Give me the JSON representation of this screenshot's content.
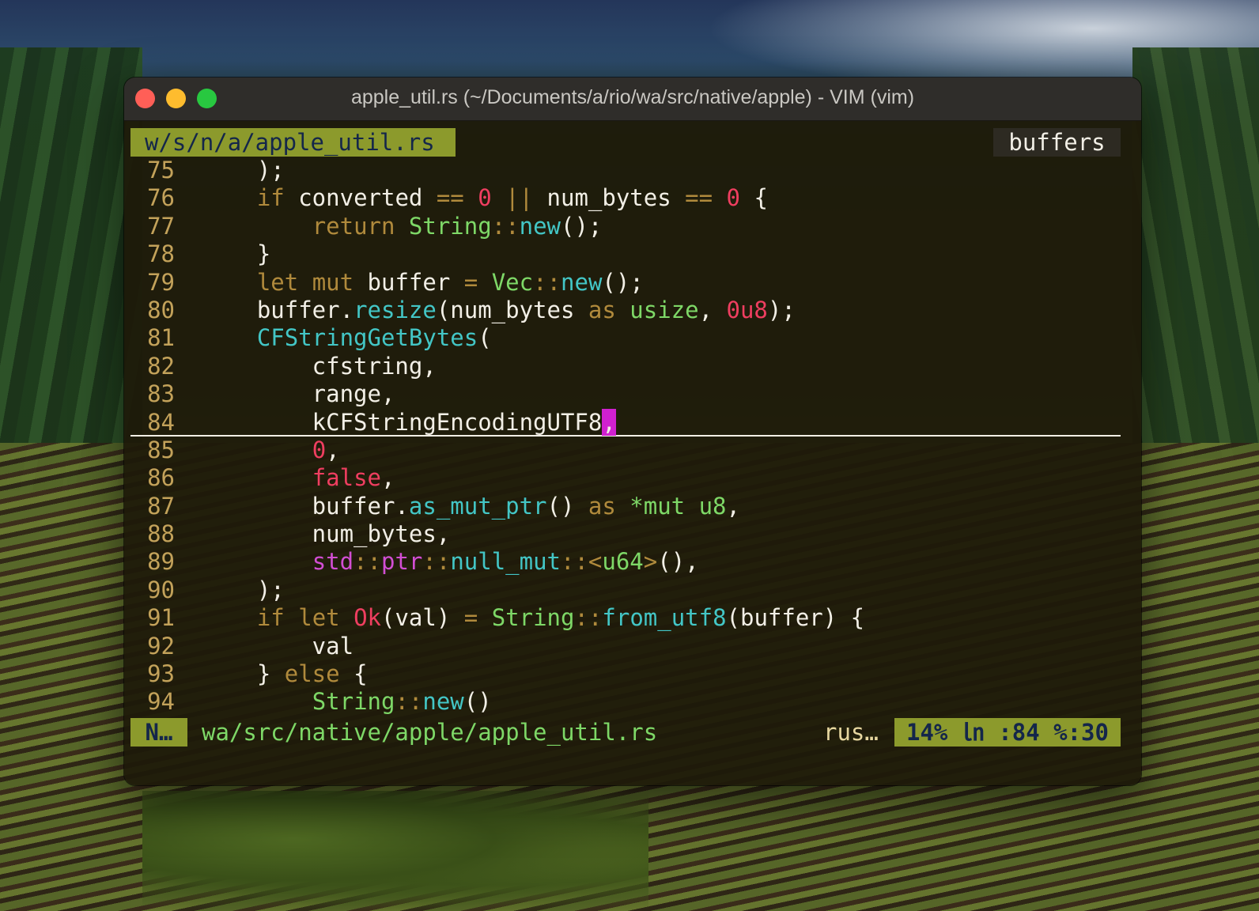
{
  "window": {
    "title": "apple_util.rs (~/Documents/a/rio/wa/src/native/apple) - VIM (vim)"
  },
  "tabline": {
    "file_tab": "w/s/n/a/apple_util.rs",
    "buffers_label": "buffers"
  },
  "editor": {
    "cursor_line": 84,
    "lines": [
      {
        "n": "75",
        "code": "    );"
      },
      {
        "n": "76",
        "code": "    if converted == 0 || num_bytes == 0 {"
      },
      {
        "n": "77",
        "code": "        return String::new();"
      },
      {
        "n": "78",
        "code": "    }"
      },
      {
        "n": "79",
        "code": "    let mut buffer = Vec::new();"
      },
      {
        "n": "80",
        "code": "    buffer.resize(num_bytes as usize, 0u8);"
      },
      {
        "n": "81",
        "code": "    CFStringGetBytes("
      },
      {
        "n": "82",
        "code": "        cfstring,"
      },
      {
        "n": "83",
        "code": "        range,"
      },
      {
        "n": "84",
        "code": "        kCFStringEncodingUTF8,"
      },
      {
        "n": "85",
        "code": "        0,"
      },
      {
        "n": "86",
        "code": "        false,"
      },
      {
        "n": "87",
        "code": "        buffer.as_mut_ptr() as *mut u8,"
      },
      {
        "n": "88",
        "code": "        num_bytes,"
      },
      {
        "n": "89",
        "code": "        std::ptr::null_mut::<u64>(),"
      },
      {
        "n": "90",
        "code": "    );"
      },
      {
        "n": "91",
        "code": "    if let Ok(val) = String::from_utf8(buffer) {"
      },
      {
        "n": "92",
        "code": "        val"
      },
      {
        "n": "93",
        "code": "    } else {"
      },
      {
        "n": "94",
        "code": "        String::new()"
      }
    ]
  },
  "statusline": {
    "mode": "N…",
    "path": "wa/src/native/apple/apple_util.rs",
    "filetype": "rus…",
    "position": "14% ㏑ :84 %:30"
  },
  "colors": {
    "accent_bar": "#8c9a2c",
    "cursor": "#d020d0",
    "keyword": "#b08a3c",
    "number": "#ef3e60",
    "type": "#7ed867",
    "function": "#43c6c6",
    "path": "#d24ed4"
  }
}
